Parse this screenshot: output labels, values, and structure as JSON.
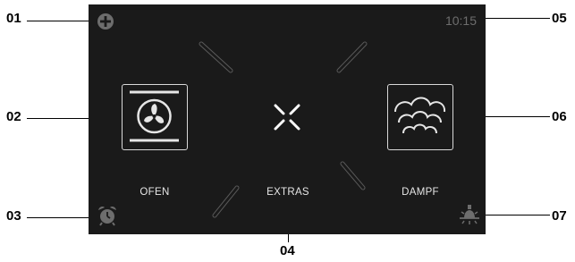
{
  "callouts": {
    "c01": "01",
    "c02": "02",
    "c03": "03",
    "c04": "04",
    "c05": "05",
    "c06": "06",
    "c07": "07"
  },
  "screen": {
    "time": "10:15",
    "menu": {
      "oven_label": "OFEN",
      "extras_label": "EXTRAS",
      "steam_label": "DAMPF"
    },
    "icons": {
      "add": "add-icon",
      "oven": "fan-icon",
      "extras": "extras-x-icon",
      "steam": "steam-clouds-icon",
      "alarm": "alarm-clock-icon",
      "light": "oven-light-icon"
    }
  },
  "colors": {
    "screen_bg": "#1a1a1a",
    "foreground": "#e6e6e6",
    "muted": "#6d6d6d"
  }
}
